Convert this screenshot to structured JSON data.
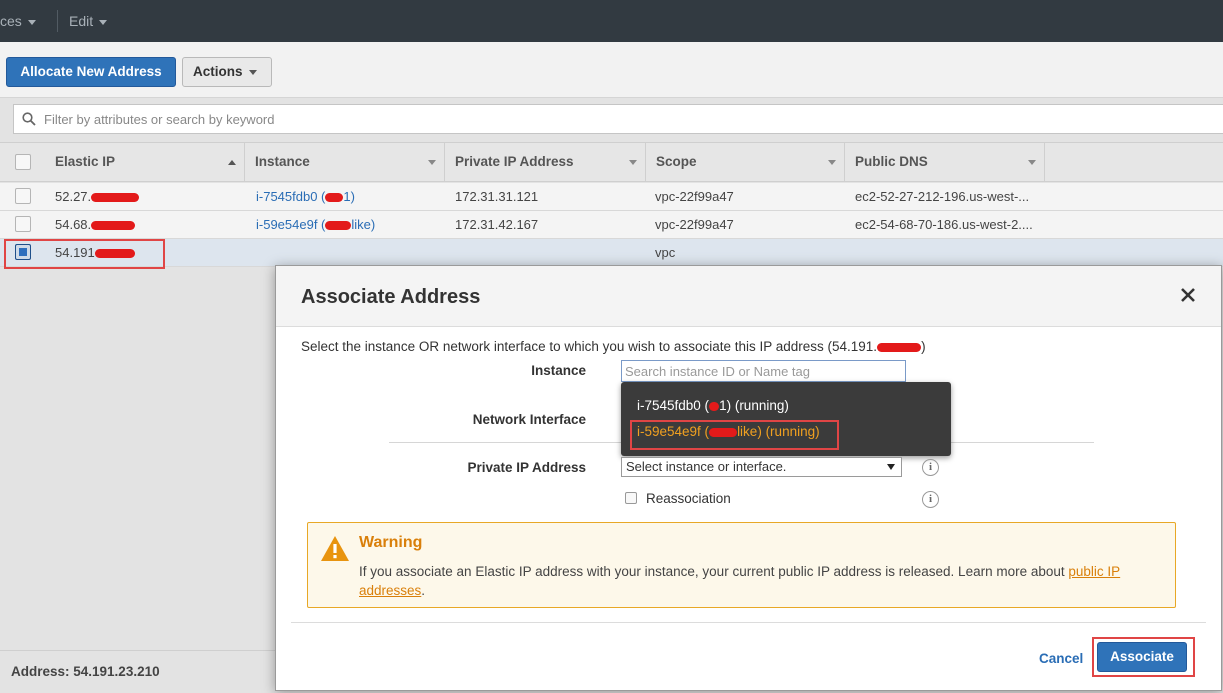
{
  "topbar": {
    "menu1": "ces",
    "menu2": "Edit"
  },
  "toolbar": {
    "allocate_label": "Allocate New Address",
    "actions_label": "Actions"
  },
  "search": {
    "placeholder": "Filter by attributes or search by keyword"
  },
  "table": {
    "columns": [
      "Elastic IP",
      "Instance",
      "Private IP Address",
      "Scope",
      "Public DNS"
    ],
    "rows": [
      {
        "eip": "52.27.",
        "instance": "i-7545fdb0 (",
        "instance_tail": "1)",
        "private_ip": "172.31.31.121",
        "scope": "vpc-22f99a47",
        "dns": "ec2-52-27-212-196.us-west-..."
      },
      {
        "eip": "54.68.",
        "instance": "i-59e54e9f (",
        "instance_tail": "like)",
        "private_ip": "172.31.42.167",
        "scope": "vpc-22f99a47",
        "dns": "ec2-54-68-70-186.us-west-2...."
      },
      {
        "eip": "54.191",
        "instance": "",
        "instance_tail": "",
        "private_ip": "",
        "scope": "vpc",
        "dns": ""
      }
    ]
  },
  "status": {
    "address": "Address: 54.191.23.210"
  },
  "dialog": {
    "title": "Associate Address",
    "description": "Select the instance OR network interface to which you wish to associate this IP address (54.191.",
    "description_tail": ")",
    "instance_label": "Instance",
    "instance_placeholder": "Search instance ID or Name tag",
    "dropdown": [
      {
        "head": "i-7545fdb0 (",
        "tail": "1) (running)"
      },
      {
        "head": "i-59e54e9f (",
        "tail": "like) (running)"
      }
    ],
    "network_interface_label": "Network Interface",
    "private_ip_label": "Private IP Address",
    "private_ip_select": "Select instance or interface.",
    "reassociation_label": "Reassociation",
    "warning_title": "Warning",
    "warning_text": "If you associate an Elastic IP address with your instance, your current public IP address is released. Learn more about ",
    "warning_link": "public IP addresses",
    "warning_end": ".",
    "cancel_label": "Cancel",
    "associate_label": "Associate"
  },
  "colors": {
    "primary": "#2f73b9",
    "warning": "#d97f0a",
    "link": "#2a6db5",
    "redaction": "#e31a1a"
  }
}
